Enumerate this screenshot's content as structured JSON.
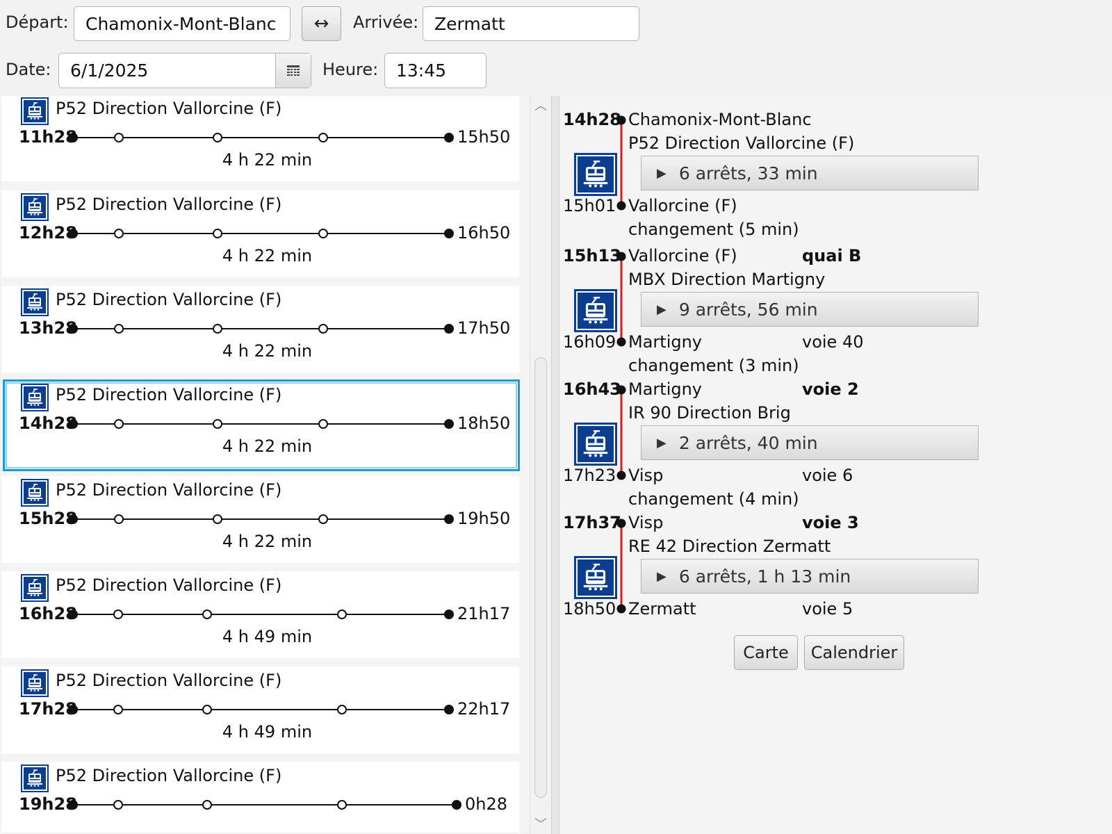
{
  "search": {
    "depart_label": "Départ:",
    "depart_value": "Chamonix-Mont-Blanc",
    "swap_label": "↔",
    "arrivee_label": "Arrivée:",
    "arrivee_value": "Zermatt",
    "date_label": "Date:",
    "date_value": "6/1/2025",
    "heure_label": "Heure:",
    "heure_value": "13:45"
  },
  "connections": [
    {
      "route": "P52 Direction Vallorcine (F)",
      "dep": "11h28",
      "arr": "15h50",
      "duration": "4 h 22 min"
    },
    {
      "route": "P52 Direction Vallorcine (F)",
      "dep": "12h28",
      "arr": "16h50",
      "duration": "4 h 22 min"
    },
    {
      "route": "P52 Direction Vallorcine (F)",
      "dep": "13h28",
      "arr": "17h50",
      "duration": "4 h 22 min"
    },
    {
      "route": "P52 Direction Vallorcine (F)",
      "dep": "14h28",
      "arr": "18h50",
      "duration": "4 h 22 min",
      "selected": true
    },
    {
      "route": "P52 Direction Vallorcine (F)",
      "dep": "15h28",
      "arr": "19h50",
      "duration": "4 h 22 min"
    },
    {
      "route": "P52 Direction Vallorcine (F)",
      "dep": "16h28",
      "arr": "21h17",
      "duration": "4 h 49 min"
    },
    {
      "route": "P52 Direction Vallorcine (F)",
      "dep": "17h28",
      "arr": "22h17",
      "duration": "4 h 49 min"
    },
    {
      "route": "P52 Direction Vallorcine (F)",
      "dep": "19h28",
      "arr": "0h28",
      "duration": ""
    }
  ],
  "detail": {
    "legs": [
      {
        "dep_time": "14h28",
        "dep_stop": "Chamonix-Mont-Blanc",
        "dep_platform": "",
        "route": "P52 Direction Vallorcine (F)",
        "stops": "6 arrêts, 33 min",
        "arr_time": "15h01",
        "arr_stop": "Vallorcine (F)",
        "arr_platform": ""
      },
      {
        "dep_time": "15h13",
        "dep_stop": "Vallorcine (F)",
        "dep_platform": "quai B",
        "route": "MBX Direction Martigny",
        "stops": "9 arrêts, 56 min",
        "arr_time": "16h09",
        "arr_stop": "Martigny",
        "arr_platform": "voie 40"
      },
      {
        "dep_time": "16h43",
        "dep_stop": "Martigny",
        "dep_platform": "voie 2",
        "route": "IR 90 Direction Brig",
        "stops": "2 arrêts, 40 min",
        "arr_time": "17h23",
        "arr_stop": "Visp",
        "arr_platform": "voie 6"
      },
      {
        "dep_time": "17h37",
        "dep_stop": "Visp",
        "dep_platform": "voie 3",
        "route": "RE 42 Direction Zermatt",
        "stops": "6 arrêts, 1 h 13 min",
        "arr_time": "18h50",
        "arr_stop": "Zermatt",
        "arr_platform": "voie 5"
      }
    ],
    "transfers": [
      "changement (5 min)",
      "changement (3 min)",
      "changement (4 min)"
    ],
    "carte_label": "Carte",
    "calendrier_label": "Calendrier"
  },
  "colors": {
    "accent": "#1a9ad6",
    "leg_line": "#d62020",
    "icon_bg": "#0b3d91"
  }
}
